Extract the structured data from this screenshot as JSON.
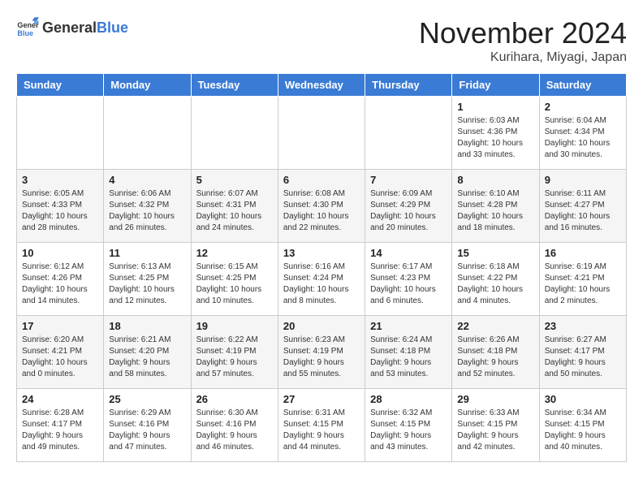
{
  "header": {
    "logo_general": "General",
    "logo_blue": "Blue",
    "month": "November 2024",
    "location": "Kurihara, Miyagi, Japan"
  },
  "days_of_week": [
    "Sunday",
    "Monday",
    "Tuesday",
    "Wednesday",
    "Thursday",
    "Friday",
    "Saturday"
  ],
  "weeks": [
    [
      {
        "day": "",
        "info": ""
      },
      {
        "day": "",
        "info": ""
      },
      {
        "day": "",
        "info": ""
      },
      {
        "day": "",
        "info": ""
      },
      {
        "day": "",
        "info": ""
      },
      {
        "day": "1",
        "info": "Sunrise: 6:03 AM\nSunset: 4:36 PM\nDaylight: 10 hours and 33 minutes."
      },
      {
        "day": "2",
        "info": "Sunrise: 6:04 AM\nSunset: 4:34 PM\nDaylight: 10 hours and 30 minutes."
      }
    ],
    [
      {
        "day": "3",
        "info": "Sunrise: 6:05 AM\nSunset: 4:33 PM\nDaylight: 10 hours and 28 minutes."
      },
      {
        "day": "4",
        "info": "Sunrise: 6:06 AM\nSunset: 4:32 PM\nDaylight: 10 hours and 26 minutes."
      },
      {
        "day": "5",
        "info": "Sunrise: 6:07 AM\nSunset: 4:31 PM\nDaylight: 10 hours and 24 minutes."
      },
      {
        "day": "6",
        "info": "Sunrise: 6:08 AM\nSunset: 4:30 PM\nDaylight: 10 hours and 22 minutes."
      },
      {
        "day": "7",
        "info": "Sunrise: 6:09 AM\nSunset: 4:29 PM\nDaylight: 10 hours and 20 minutes."
      },
      {
        "day": "8",
        "info": "Sunrise: 6:10 AM\nSunset: 4:28 PM\nDaylight: 10 hours and 18 minutes."
      },
      {
        "day": "9",
        "info": "Sunrise: 6:11 AM\nSunset: 4:27 PM\nDaylight: 10 hours and 16 minutes."
      }
    ],
    [
      {
        "day": "10",
        "info": "Sunrise: 6:12 AM\nSunset: 4:26 PM\nDaylight: 10 hours and 14 minutes."
      },
      {
        "day": "11",
        "info": "Sunrise: 6:13 AM\nSunset: 4:25 PM\nDaylight: 10 hours and 12 minutes."
      },
      {
        "day": "12",
        "info": "Sunrise: 6:15 AM\nSunset: 4:25 PM\nDaylight: 10 hours and 10 minutes."
      },
      {
        "day": "13",
        "info": "Sunrise: 6:16 AM\nSunset: 4:24 PM\nDaylight: 10 hours and 8 minutes."
      },
      {
        "day": "14",
        "info": "Sunrise: 6:17 AM\nSunset: 4:23 PM\nDaylight: 10 hours and 6 minutes."
      },
      {
        "day": "15",
        "info": "Sunrise: 6:18 AM\nSunset: 4:22 PM\nDaylight: 10 hours and 4 minutes."
      },
      {
        "day": "16",
        "info": "Sunrise: 6:19 AM\nSunset: 4:21 PM\nDaylight: 10 hours and 2 minutes."
      }
    ],
    [
      {
        "day": "17",
        "info": "Sunrise: 6:20 AM\nSunset: 4:21 PM\nDaylight: 10 hours and 0 minutes."
      },
      {
        "day": "18",
        "info": "Sunrise: 6:21 AM\nSunset: 4:20 PM\nDaylight: 9 hours and 58 minutes."
      },
      {
        "day": "19",
        "info": "Sunrise: 6:22 AM\nSunset: 4:19 PM\nDaylight: 9 hours and 57 minutes."
      },
      {
        "day": "20",
        "info": "Sunrise: 6:23 AM\nSunset: 4:19 PM\nDaylight: 9 hours and 55 minutes."
      },
      {
        "day": "21",
        "info": "Sunrise: 6:24 AM\nSunset: 4:18 PM\nDaylight: 9 hours and 53 minutes."
      },
      {
        "day": "22",
        "info": "Sunrise: 6:26 AM\nSunset: 4:18 PM\nDaylight: 9 hours and 52 minutes."
      },
      {
        "day": "23",
        "info": "Sunrise: 6:27 AM\nSunset: 4:17 PM\nDaylight: 9 hours and 50 minutes."
      }
    ],
    [
      {
        "day": "24",
        "info": "Sunrise: 6:28 AM\nSunset: 4:17 PM\nDaylight: 9 hours and 49 minutes."
      },
      {
        "day": "25",
        "info": "Sunrise: 6:29 AM\nSunset: 4:16 PM\nDaylight: 9 hours and 47 minutes."
      },
      {
        "day": "26",
        "info": "Sunrise: 6:30 AM\nSunset: 4:16 PM\nDaylight: 9 hours and 46 minutes."
      },
      {
        "day": "27",
        "info": "Sunrise: 6:31 AM\nSunset: 4:15 PM\nDaylight: 9 hours and 44 minutes."
      },
      {
        "day": "28",
        "info": "Sunrise: 6:32 AM\nSunset: 4:15 PM\nDaylight: 9 hours and 43 minutes."
      },
      {
        "day": "29",
        "info": "Sunrise: 6:33 AM\nSunset: 4:15 PM\nDaylight: 9 hours and 42 minutes."
      },
      {
        "day": "30",
        "info": "Sunrise: 6:34 AM\nSunset: 4:15 PM\nDaylight: 9 hours and 40 minutes."
      }
    ]
  ]
}
